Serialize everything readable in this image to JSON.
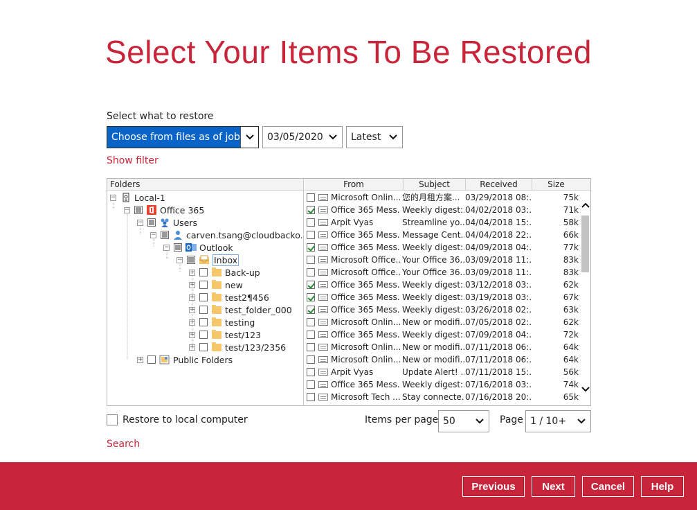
{
  "title": "Select Your Items To Be Restored",
  "restore_label": "Select what to restore",
  "job_dropdown": "Choose from files as of job",
  "date_dropdown": "03/05/2020",
  "version_dropdown": "Latest",
  "show_filter": "Show filter",
  "tree": {
    "header": "Folders",
    "nodes": [
      {
        "label": "Local-1",
        "icon": "hard-drive-icon"
      },
      {
        "label": "Office 365",
        "icon": "office365-icon"
      },
      {
        "label": "Users",
        "icon": "users-icon"
      },
      {
        "label": "carven.tsang@cloudbacko.biz",
        "icon": "user-icon"
      },
      {
        "label": "Outlook",
        "icon": "outlook-icon"
      },
      {
        "label": "Inbox",
        "icon": "inbox-icon"
      },
      {
        "label": "Back-up",
        "icon": "folder-icon"
      },
      {
        "label": "new",
        "icon": "folder-icon"
      },
      {
        "label": "test2¶456",
        "icon": "folder-icon"
      },
      {
        "label": "test_folder_000",
        "icon": "folder-icon"
      },
      {
        "label": "testing",
        "icon": "folder-icon"
      },
      {
        "label": "test/123",
        "icon": "folder-icon"
      },
      {
        "label": "test/123/2356",
        "icon": "folder-icon"
      },
      {
        "label": "Public Folders",
        "icon": "public-folder-icon"
      }
    ]
  },
  "list": {
    "columns": [
      "From",
      "Subject",
      "Received",
      "Size"
    ],
    "rows": [
      {
        "checked": false,
        "from": "Microsoft Onlin...",
        "subject": "您的月租方案...",
        "received": "03/29/2018 08:...",
        "size": "75k"
      },
      {
        "checked": true,
        "from": "Office 365 Mess...",
        "subject": "Weekly digest:...",
        "received": "04/02/2018 03:...",
        "size": "71k"
      },
      {
        "checked": false,
        "from": "Arpit Vyas",
        "subject": "Streamline yo...",
        "received": "04/04/2018 15:...",
        "size": "58k"
      },
      {
        "checked": false,
        "from": "Office 365 Mess...",
        "subject": "Message Cent...",
        "received": "04/04/2018 22:...",
        "size": "66k"
      },
      {
        "checked": true,
        "from": "Office 365 Mess...",
        "subject": "Weekly digest:...",
        "received": "04/09/2018 04:...",
        "size": "77k"
      },
      {
        "checked": false,
        "from": "Microsoft Office...",
        "subject": "Your Office 36...",
        "received": "03/09/2018 11:...",
        "size": "83k"
      },
      {
        "checked": false,
        "from": "Microsoft Office...",
        "subject": "Your Office 36...",
        "received": "03/09/2018 11:...",
        "size": "83k"
      },
      {
        "checked": true,
        "from": "Office 365 Mess...",
        "subject": "Weekly digest:...",
        "received": "03/12/2018 03:...",
        "size": "62k"
      },
      {
        "checked": true,
        "from": "Office 365 Mess...",
        "subject": "Weekly digest:...",
        "received": "03/19/2018 03:...",
        "size": "67k"
      },
      {
        "checked": true,
        "from": "Office 365 Mess...",
        "subject": "Weekly digest:...",
        "received": "03/26/2018 02:...",
        "size": "63k"
      },
      {
        "checked": false,
        "from": "Microsoft Onlin...",
        "subject": "New or modifi...",
        "received": "07/05/2018 02:...",
        "size": "62k"
      },
      {
        "checked": false,
        "from": "Office 365 Mess...",
        "subject": "Weekly digest:...",
        "received": "07/09/2018 04:...",
        "size": "72k"
      },
      {
        "checked": false,
        "from": "Microsoft Onlin...",
        "subject": "New or modifi...",
        "received": "07/11/2018 06:...",
        "size": "64k"
      },
      {
        "checked": false,
        "from": "Microsoft Onlin...",
        "subject": "New or modifi...",
        "received": "07/11/2018 06:...",
        "size": "64k"
      },
      {
        "checked": false,
        "from": "Arpit Vyas",
        "subject": "Update Alert! ...",
        "received": "07/11/2018 15:...",
        "size": "56k"
      },
      {
        "checked": false,
        "from": "Office 365 Mess...",
        "subject": "Weekly digest:...",
        "received": "07/16/2018 03:...",
        "size": "74k"
      },
      {
        "checked": false,
        "from": "Microsoft Tech ...",
        "subject": "Stay connecte...",
        "received": "07/16/2018 20:...",
        "size": "65k"
      }
    ]
  },
  "restore_local": "Restore to local computer",
  "items_per_page_label": "Items per page",
  "items_per_page": "50",
  "page_label": "Page",
  "page_value": "1 / 10+",
  "search": "Search",
  "buttons": {
    "previous": "Previous",
    "next": "Next",
    "cancel": "Cancel",
    "help": "Help"
  },
  "colors": {
    "brand": "#c8253a",
    "selection": "#0a64c8"
  }
}
